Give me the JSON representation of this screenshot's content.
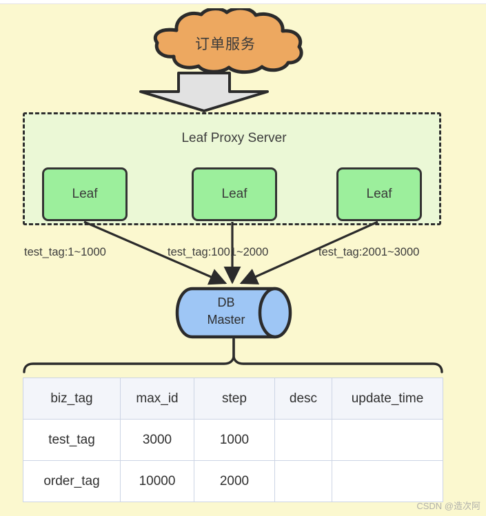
{
  "diagram": {
    "background_color": "#fbf8cf",
    "cloud": {
      "label": "订单服务",
      "fill": "#eda860",
      "stroke": "#2b2b2b"
    },
    "flow_arrow": {
      "name": "cloud-to-proxy-arrow",
      "direction": "down",
      "fill": "#e2e2e2",
      "stroke": "#2b2b2b"
    },
    "proxy": {
      "title": "Leaf Proxy Server",
      "fill": "#ebf8d6",
      "stroke": "#2e2e2e",
      "nodes": [
        {
          "label": "Leaf"
        },
        {
          "label": "Leaf"
        },
        {
          "label": "Leaf"
        }
      ],
      "node_fill": "#9cef9c"
    },
    "range_labels": [
      {
        "text": "test_tag:1~1000"
      },
      {
        "text": "test_tag:1001~2000"
      },
      {
        "text": "test_tag:2001~3000"
      }
    ],
    "database": {
      "line1": "DB",
      "line2": "Master",
      "fill": "#9ec6f5",
      "stroke": "#2b2b2b"
    },
    "table": {
      "headers": [
        "biz_tag",
        "max_id",
        "step",
        "desc",
        "update_time"
      ],
      "rows": [
        [
          "test_tag",
          "3000",
          "1000",
          "",
          ""
        ],
        [
          "order_tag",
          "10000",
          "2000",
          "",
          ""
        ]
      ],
      "header_fill": "#f3f5fa",
      "border_color": "#ccd4e4"
    },
    "watermark": "CSDN @造次阿"
  }
}
